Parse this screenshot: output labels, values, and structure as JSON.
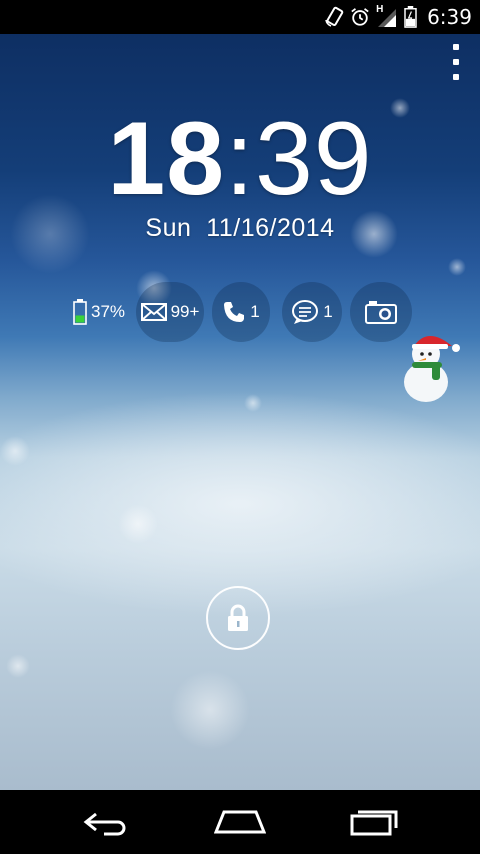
{
  "status_bar": {
    "time": "6:39",
    "network_type": "H",
    "icons": [
      "rotation-icon",
      "alarm-icon",
      "signal-icon",
      "battery-icon"
    ]
  },
  "lockscreen": {
    "clock": {
      "hours": "18",
      "separator": ":",
      "minutes": "39"
    },
    "date": "Sun  11/16/2014",
    "notifications": {
      "battery": {
        "icon": "battery-icon",
        "value": "37%",
        "level": 0.37
      },
      "mail": {
        "icon": "mail-icon",
        "value": "99+"
      },
      "calls": {
        "icon": "phone-icon",
        "value": "1"
      },
      "messages": {
        "icon": "message-icon",
        "value": "1"
      },
      "camera": {
        "icon": "camera-icon"
      }
    },
    "unlock": {
      "icon": "lock-icon"
    },
    "menu": {
      "icon": "overflow-menu-icon"
    }
  },
  "nav_bar": {
    "buttons": [
      "back-icon",
      "home-icon",
      "recents-icon"
    ]
  },
  "colors": {
    "battery_fill": "#3ad23a",
    "sky_top": "#0e2f63",
    "snow": "#c9dbe7"
  }
}
